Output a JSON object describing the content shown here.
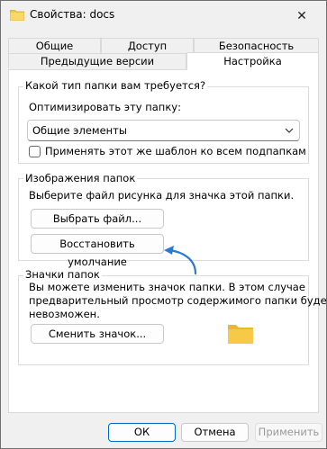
{
  "window": {
    "title": "Свойства: docs",
    "close_glyph": "✕"
  },
  "tabs": {
    "row1": [
      "Общие",
      "Доступ",
      "Безопасность"
    ],
    "row2_prev": "Предыдущие версии",
    "row2_active": "Настройка"
  },
  "folder_type": {
    "question": "Какой тип папки вам требуется?",
    "optimize_label": "Оптимизировать эту папку:",
    "selected_option": "Общие элементы",
    "apply_subfolders_label": "Применять этот же шаблон ко всем подпапкам",
    "apply_subfolders_checked": false
  },
  "folder_pictures": {
    "group_label": "Изображения папок",
    "description": "Выберите файл рисунка для значка этой папки.",
    "choose_file_button": "Выбрать файл...",
    "restore_default_button": "Восстановить умолчание"
  },
  "folder_icons": {
    "group_label": "Значки папок",
    "description_lines": [
      "Вы можете изменить значок папки. В этом случае",
      "предварительный просмотр содержимого папки будет",
      "невозможен."
    ],
    "change_icon_button": "Сменить значок..."
  },
  "dialog_buttons": {
    "ok": "ОК",
    "cancel": "Отмена",
    "apply": "Применить",
    "apply_enabled": false
  },
  "colors": {
    "arrow": "#2a7ad5",
    "folder_yellow": "#f7c948",
    "disabled_text": "#9a9a9a"
  }
}
